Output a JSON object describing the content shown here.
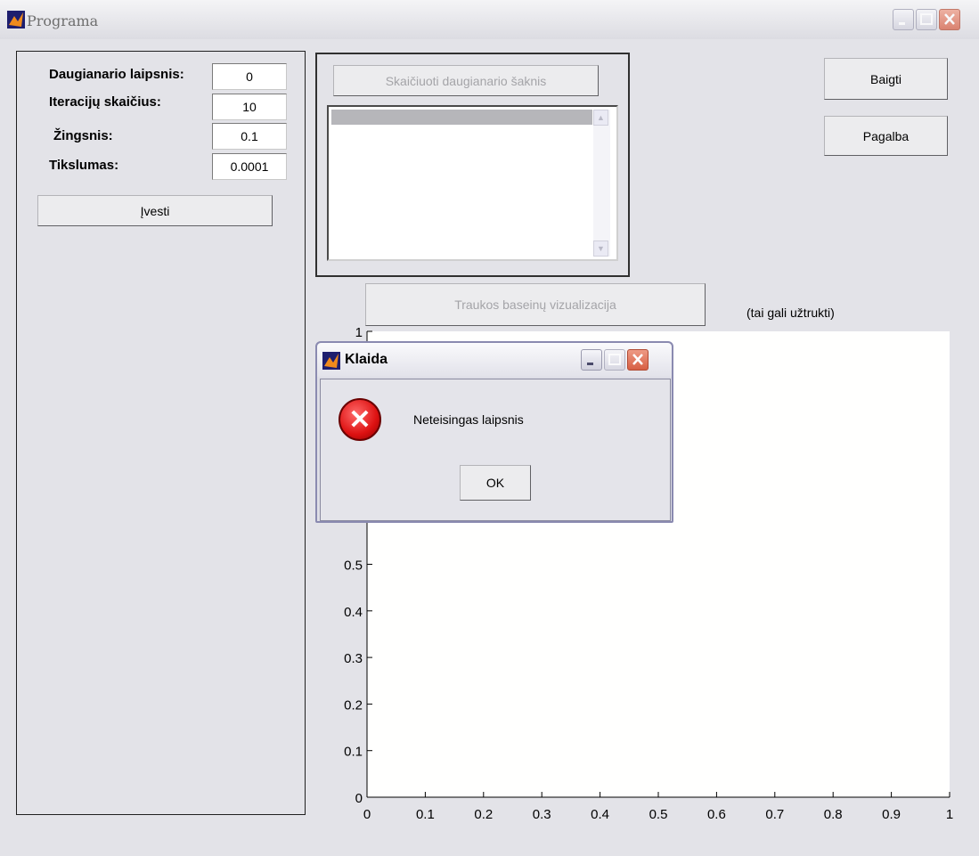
{
  "window": {
    "title": "Programa"
  },
  "params": {
    "degree": {
      "label": "Daugianario laipsnis:",
      "value": "0"
    },
    "iterations": {
      "label": "Iteracijų skaičius:",
      "value": "10"
    },
    "step": {
      "label": "Žingsnis:",
      "value": "0.1"
    },
    "precision": {
      "label": "Tikslumas:",
      "value": "0.0001"
    },
    "enter_button": "Įvesti"
  },
  "roots": {
    "compute_button": "Skaičiuoti daugianario šaknis"
  },
  "actions": {
    "quit": "Baigti",
    "help": "Pagalba"
  },
  "visualization": {
    "button": "Traukos baseinų vizualizacija",
    "note": "(tai gali užtrukti)"
  },
  "chart_data": {
    "type": "line",
    "title": "",
    "xlabel": "",
    "ylabel": "",
    "xlim": [
      0,
      1
    ],
    "ylim": [
      0,
      1
    ],
    "x_ticks": [
      "0",
      "0.1",
      "0.2",
      "0.3",
      "0.4",
      "0.5",
      "0.6",
      "0.7",
      "0.8",
      "0.9",
      "1"
    ],
    "y_ticks_visible": [
      "0",
      "0.1",
      "0.2",
      "0.3",
      "0.4",
      "0.5",
      "1"
    ],
    "series": []
  },
  "dialog": {
    "title": "Klaida",
    "message": "Neteisingas laipsnis",
    "ok": "OK"
  },
  "colors": {
    "error_red": "#dd1111",
    "close_button": "#d75f44",
    "plot_background": "#fffffe",
    "window_background": "#e3e3e8"
  }
}
